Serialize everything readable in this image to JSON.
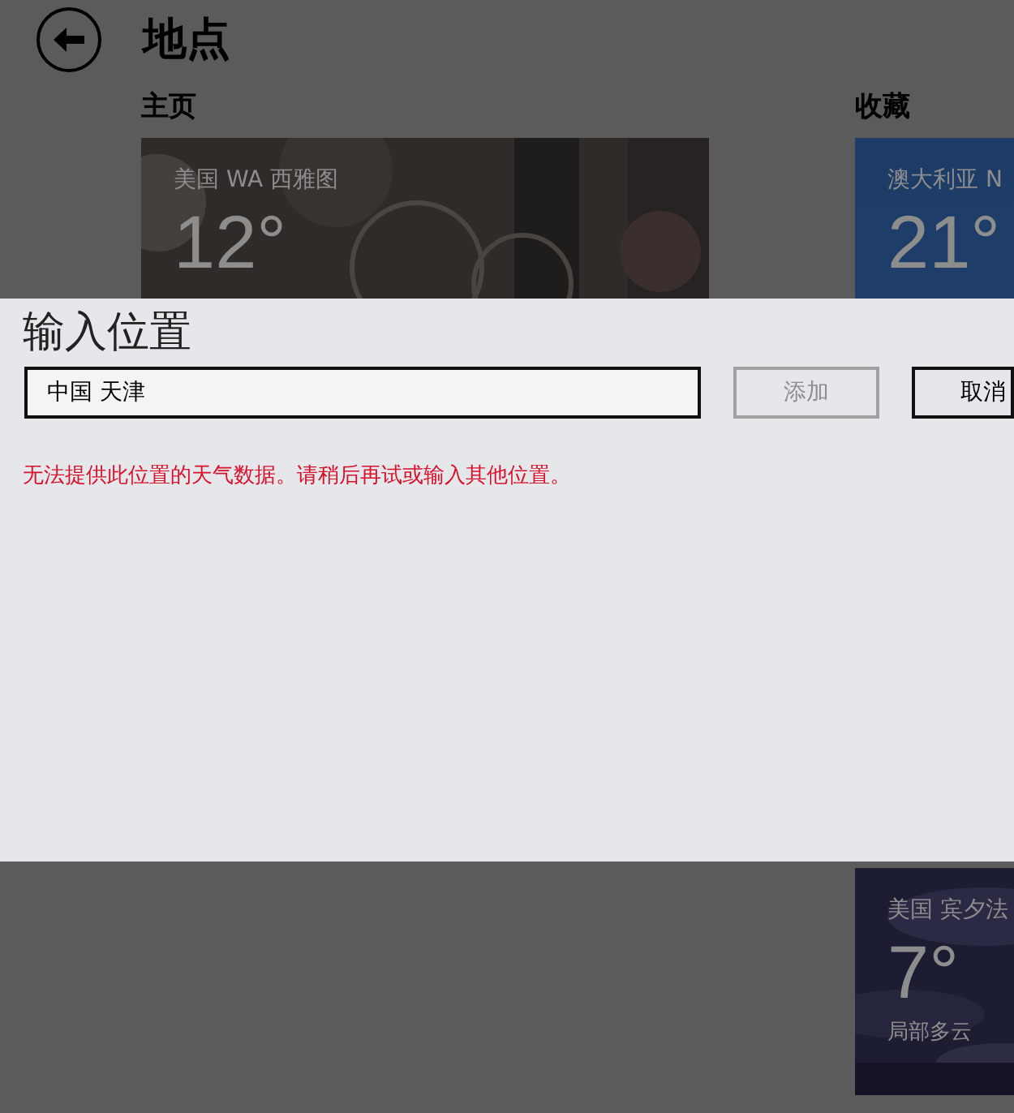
{
  "header": {
    "title": "地点"
  },
  "home": {
    "heading": "主页",
    "tiles": [
      {
        "kind": "picture",
        "location": "美国 WA 西雅图",
        "temperature": "12°"
      }
    ]
  },
  "favorites": {
    "heading": "收藏",
    "tiles": [
      {
        "kind": "plain",
        "location": "澳大利亚 N",
        "temperature": "21°"
      },
      {
        "kind": "picture",
        "location": "美国 宾夕法",
        "temperature": "7°",
        "condition": "局部多云"
      }
    ]
  },
  "dialog": {
    "title": "输入位置",
    "input": {
      "value": "中国 天津"
    },
    "buttons": [
      {
        "label": "添加",
        "disabled": true
      },
      {
        "label": "取消",
        "disabled": false
      }
    ],
    "error": "无法提供此位置的天气数据。请稍后再试或输入其他位置。"
  }
}
